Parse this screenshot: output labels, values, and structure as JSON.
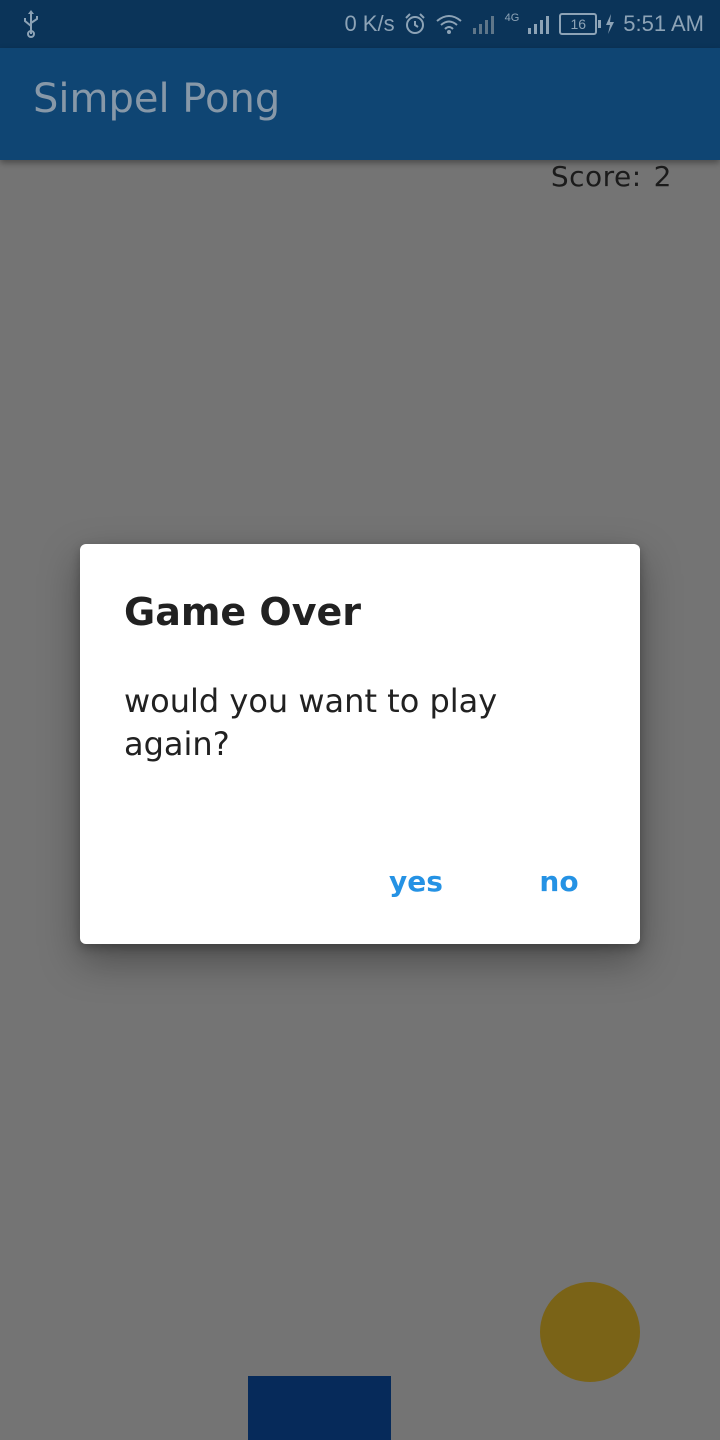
{
  "status_bar": {
    "network_speed": "0 K/s",
    "network_type": "4G",
    "battery_level": "16",
    "time": "5:51 AM",
    "icons": [
      "usb-icon",
      "alarm-icon",
      "wifi-icon",
      "signal-icon",
      "battery-icon",
      "charging-icon"
    ]
  },
  "app_bar": {
    "title": "Simpel Pong"
  },
  "game": {
    "score_label": "Score:",
    "score_value": "2",
    "ball_color": "#7a6317",
    "paddle_color": "#062a5a"
  },
  "dialog": {
    "title": "Game Over",
    "message": "would you want to play again?",
    "yes_label": "yes",
    "no_label": "no",
    "button_color": "#2592e4"
  }
}
